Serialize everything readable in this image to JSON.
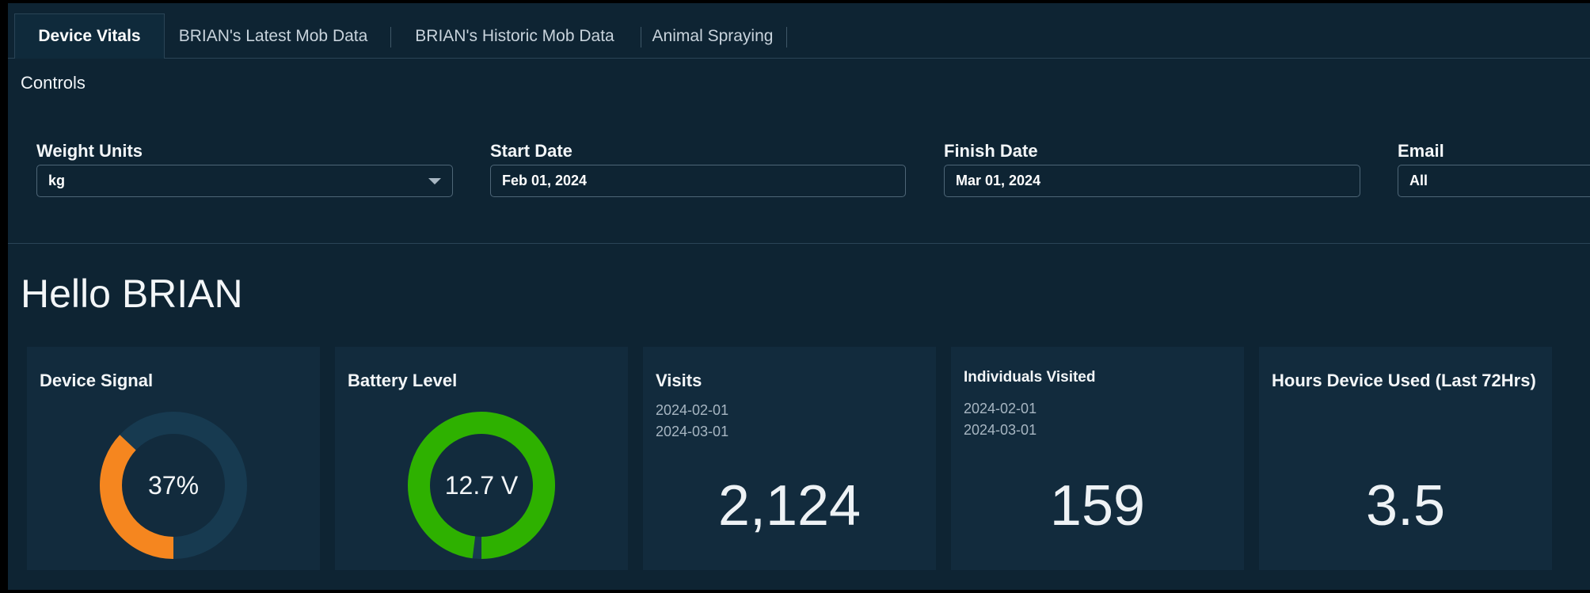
{
  "tabs": [
    {
      "label": "Device Vitals",
      "active": true
    },
    {
      "label": "BRIAN's Latest Mob Data",
      "active": false
    },
    {
      "label": "BRIAN's Historic Mob Data",
      "active": false
    },
    {
      "label": "Animal Spraying",
      "active": false
    }
  ],
  "controls": {
    "title": "Controls",
    "weight_units": {
      "label": "Weight Units",
      "value": "kg"
    },
    "start_date": {
      "label": "Start Date",
      "value": "Feb 01, 2024"
    },
    "finish_date": {
      "label": "Finish Date",
      "value": "Mar 01, 2024"
    },
    "email": {
      "label": "Email",
      "value": "All"
    }
  },
  "greeting": "Hello BRIAN",
  "cards": {
    "device_signal": {
      "title": "Device Signal",
      "value": "37%",
      "fraction": 0.37,
      "color": "#f5861f",
      "track": "#173a50"
    },
    "battery_level": {
      "title": "Battery Level",
      "value": "12.7 V",
      "fraction": 0.98,
      "color": "#2eb100",
      "track": "#173a50"
    },
    "visits": {
      "title": "Visits",
      "from": "2024-02-01",
      "to": "2024-03-01",
      "value": "2,124"
    },
    "individuals_visited": {
      "title": "Individuals Visited",
      "from": "2024-02-01",
      "to": "2024-03-01",
      "value": "159"
    },
    "hours_used": {
      "title": "Hours Device Used (Last 72Hrs)",
      "value": "3.5"
    }
  },
  "colors": {
    "background": "#0e2433",
    "card": "#122b3d",
    "border": "#2a4456"
  }
}
